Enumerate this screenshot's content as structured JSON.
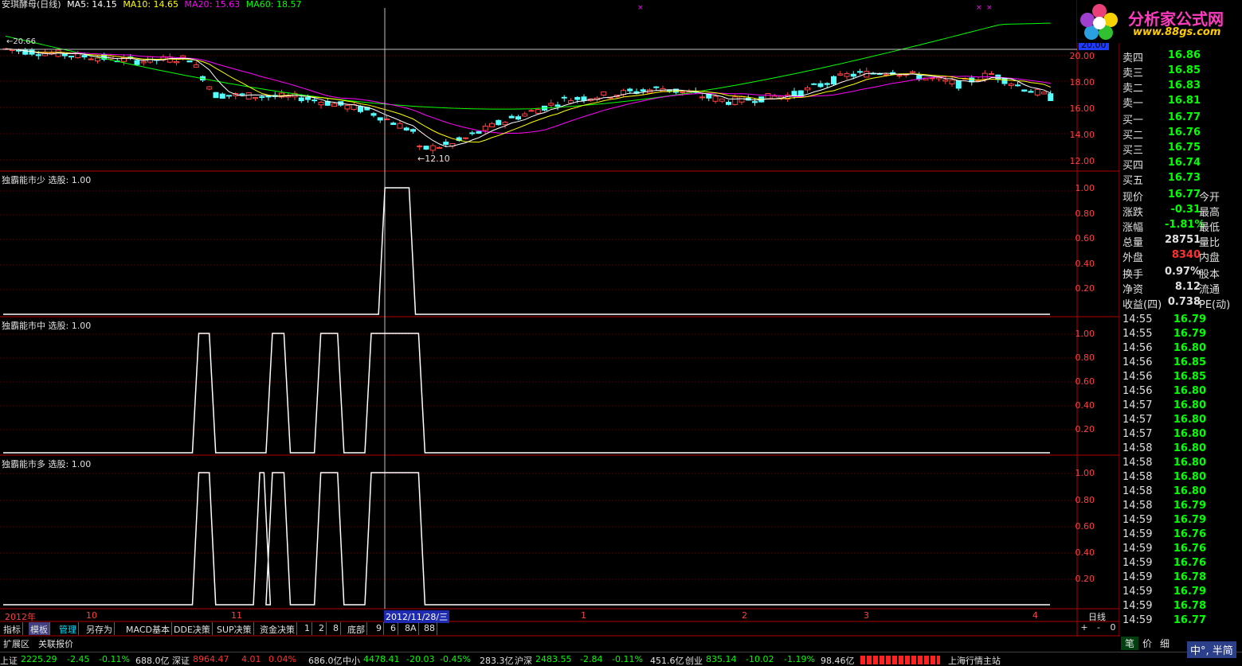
{
  "header": {
    "stock": "安琪酵母(日线)",
    "ma5": "MA5: 14.15",
    "ma10": "MA10: 14.65",
    "ma20": "MA20: 15.63",
    "ma60": "MA60: 18.57",
    "ma_colors": {
      "ma5": "#ffffff",
      "ma10": "#ffff00",
      "ma20": "#ff00ff",
      "ma60": "#00ff00"
    },
    "current_line_label": "20.00"
  },
  "logo": {
    "title": "分析家公式网",
    "url": "www.88gs.com"
  },
  "price_axis": [
    "20.00",
    "18.00",
    "16.00",
    "14.00",
    "12.00"
  ],
  "annotations": {
    "high": "←20.66 ",
    "low": "←12.10"
  },
  "panels": [
    {
      "label": "独霸能市少  选股: 1.00",
      "axis": [
        "1.00",
        "0.80",
        "0.60",
        "0.40",
        "0.20"
      ]
    },
    {
      "label": "独霸能市中  选股: 1.00",
      "axis": [
        "1.00",
        "0.80",
        "0.60",
        "0.40",
        "0.20"
      ]
    },
    {
      "label": "独霸能市多  选股: 1.00",
      "axis": [
        "1.00",
        "0.80",
        "0.60",
        "0.40",
        "0.20"
      ]
    }
  ],
  "order_book": {
    "sell": [
      {
        "label": "卖四",
        "price": "16.86"
      },
      {
        "label": "卖三",
        "price": "16.85"
      },
      {
        "label": "卖二",
        "price": "16.83"
      },
      {
        "label": "卖一",
        "price": "16.81"
      }
    ],
    "buy": [
      {
        "label": "买一",
        "price": "16.77"
      },
      {
        "label": "买二",
        "price": "16.76"
      },
      {
        "label": "买三",
        "price": "16.75"
      },
      {
        "label": "买四",
        "price": "16.74"
      },
      {
        "label": "买五",
        "price": "16.73"
      }
    ]
  },
  "quote": [
    {
      "k": "现价",
      "v": "16.77",
      "c": "g",
      "k2": "今开"
    },
    {
      "k": "涨跌",
      "v": "-0.31",
      "c": "g",
      "k2": "最高"
    },
    {
      "k": "涨幅",
      "v": "-1.81%",
      "c": "g",
      "k2": "最低"
    },
    {
      "k": "总量",
      "v": "28751",
      "c": "w",
      "k2": "量比"
    },
    {
      "k": "外盘",
      "v": "8340",
      "c": "r",
      "k2": "内盘"
    }
  ],
  "fundamentals": [
    {
      "k": "换手",
      "v": "0.97%",
      "k2": "股本"
    },
    {
      "k": "净资",
      "v": "8.12",
      "k2": "流通"
    },
    {
      "k": "收益(四)",
      "v": "0.738",
      "k2": "PE(动)"
    }
  ],
  "ticks": [
    {
      "t": "14:55",
      "p": "16.79"
    },
    {
      "t": "14:55",
      "p": "16.79"
    },
    {
      "t": "14:56",
      "p": "16.80"
    },
    {
      "t": "14:56",
      "p": "16.85"
    },
    {
      "t": "14:56",
      "p": "16.85"
    },
    {
      "t": "14:56",
      "p": "16.80"
    },
    {
      "t": "14:57",
      "p": "16.80"
    },
    {
      "t": "14:57",
      "p": "16.80"
    },
    {
      "t": "14:57",
      "p": "16.80"
    },
    {
      "t": "14:58",
      "p": "16.80"
    },
    {
      "t": "14:58",
      "p": "16.80"
    },
    {
      "t": "14:58",
      "p": "16.80"
    },
    {
      "t": "14:58",
      "p": "16.80"
    },
    {
      "t": "14:58",
      "p": "16.79"
    },
    {
      "t": "14:59",
      "p": "16.79"
    },
    {
      "t": "14:59",
      "p": "16.76"
    },
    {
      "t": "14:59",
      "p": "16.76"
    },
    {
      "t": "14:59",
      "p": "16.76"
    },
    {
      "t": "14:59",
      "p": "16.78"
    },
    {
      "t": "14:59",
      "p": "16.79"
    },
    {
      "t": "14:59",
      "p": "16.78"
    },
    {
      "t": "14:59",
      "p": "16.77"
    }
  ],
  "date_axis": {
    "labels": [
      "2012年",
      "10",
      "11",
      "1",
      "2",
      "3",
      "4"
    ],
    "cursor": "2012/11/28/三",
    "period": "日线"
  },
  "toolbar": [
    "指标",
    "模板",
    "管理",
    "另存为",
    "MACD基本",
    "DDE决策",
    "SUP决策",
    "资金决策",
    "1",
    "2",
    "8",
    "底部",
    "9",
    "6",
    "8A",
    "88"
  ],
  "toolbar_right": [
    "+",
    "-",
    "0"
  ],
  "tabs": [
    "扩展区",
    "关联报价"
  ],
  "right_tabs": [
    "笔",
    "价",
    "细"
  ],
  "status": {
    "sh": "上证",
    "sh_v": "2225.29",
    "sh_c": "-2.45",
    "sh_p": "-0.11%",
    "sh_a": "688.0亿",
    "sz": "深证",
    "sz_v": "8964.47",
    "sz_c": "4.01",
    "sz_p": "0.04%",
    "sz_a": "686.0亿",
    "zx": "中小",
    "zx_v": "4478.41",
    "zx_c": "-20.03",
    "zx_p": "-0.45%",
    "zx_a": "283.3亿",
    "hs": "沪深",
    "hs_v": "2483.55",
    "hs_c": "-2.84",
    "hs_p": "-0.11%",
    "hs_a": "451.6亿",
    "cy": "创业",
    "cy_v": "835.14",
    "cy_c": "-10.02",
    "cy_p": "-1.19%",
    "cy_a": "98.46亿",
    "station": "上海行情主站",
    "ime": "中°, 半简"
  },
  "signals": {
    "note": "date index ranges where each selector equals 1 (fraction of chart width)",
    "shao": [
      [
        0.363,
        0.386
      ]
    ],
    "zhong": [
      [
        0.186,
        0.196
      ],
      [
        0.256,
        0.267
      ],
      [
        0.302,
        0.318
      ],
      [
        0.35,
        0.395
      ]
    ],
    "duo": [
      [
        0.186,
        0.196
      ],
      [
        0.244,
        0.248
      ],
      [
        0.256,
        0.267
      ],
      [
        0.302,
        0.318
      ],
      [
        0.35,
        0.395
      ]
    ]
  }
}
